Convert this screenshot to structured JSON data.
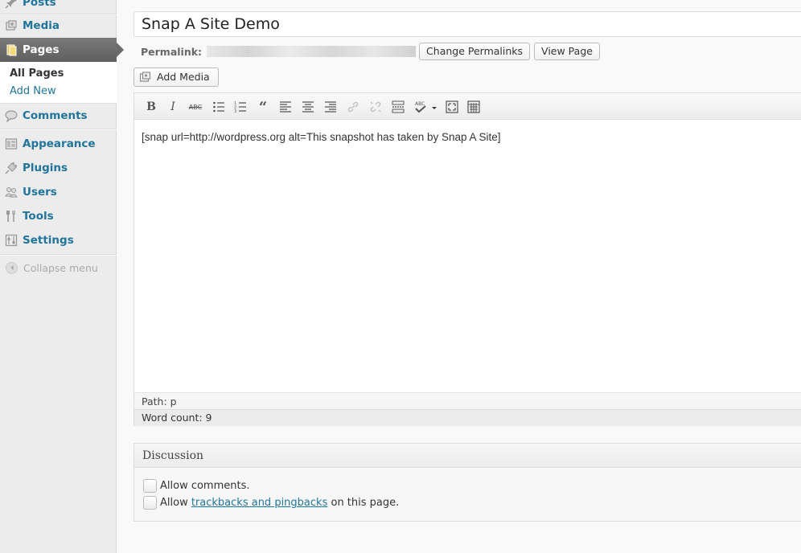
{
  "sidebar": {
    "items": [
      {
        "label": "Posts",
        "icon": "pin-icon"
      },
      {
        "label": "Media",
        "icon": "media-icon"
      },
      {
        "label": "Pages",
        "icon": "pages-icon"
      },
      {
        "label": "Comments",
        "icon": "comments-icon"
      },
      {
        "label": "Appearance",
        "icon": "appearance-icon"
      },
      {
        "label": "Plugins",
        "icon": "plugins-icon"
      },
      {
        "label": "Users",
        "icon": "users-icon"
      },
      {
        "label": "Tools",
        "icon": "tools-icon"
      },
      {
        "label": "Settings",
        "icon": "settings-icon"
      }
    ],
    "submenu": {
      "all_pages": "All Pages",
      "add_new": "Add New"
    },
    "collapse_label": "Collapse menu"
  },
  "editor": {
    "title_value": "Snap A Site Demo",
    "permalink_label": "Permalink:",
    "change_permalinks_label": "Change Permalinks",
    "view_page_label": "View Page",
    "add_media_label": "Add Media",
    "toolbar": [
      "bold",
      "italic",
      "strikethrough",
      "bullet-list",
      "numbered-list",
      "blockquote",
      "align-left",
      "align-center",
      "align-right",
      "insert-link",
      "remove-link",
      "insert-more",
      "spellcheck",
      "fullscreen",
      "toolbar-toggle"
    ],
    "content": "[snap url=http://wordpress.org alt=This snapshot has taken by Snap A Site]",
    "path": "Path: p",
    "word_count": "Word count: 9"
  },
  "discussion": {
    "title": "Discussion",
    "allow_comments": "Allow comments.",
    "allow_prefix": "Allow",
    "trackbacks_link": "trackbacks and pingbacks",
    "allow_suffix": "on this page."
  },
  "colors": {
    "link": "#21759b",
    "active_menu": "#6a6a6a",
    "sidebar_bg": "#ececec"
  }
}
